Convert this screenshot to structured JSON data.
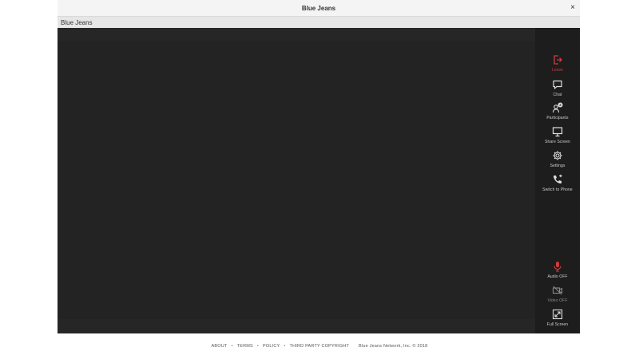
{
  "window": {
    "title": "Blue Jeans",
    "close_glyph": "×",
    "tab_label": "Blue Jeans"
  },
  "sidebar": {
    "leave": {
      "label": "Leave",
      "icon": "leave-icon",
      "color": "#d23a3a"
    },
    "chat": {
      "label": "Chat",
      "icon": "chat-icon"
    },
    "participants": {
      "label": "Participants",
      "icon": "participants-icon",
      "count": "2"
    },
    "share_screen": {
      "label": "Share Screen",
      "icon": "monitor-icon"
    },
    "settings": {
      "label": "Settings",
      "icon": "gear-icon"
    },
    "switch_to_phone": {
      "label": "Switch to Phone",
      "icon": "phone-icon"
    },
    "audio": {
      "label": "Audio OFF",
      "icon": "microphone-muted-icon",
      "color": "#d23a3a"
    },
    "video": {
      "label": "Video OFF",
      "icon": "camera-off-icon"
    },
    "full_screen": {
      "label": "Full Screen",
      "icon": "fullscreen-icon"
    }
  },
  "footer": {
    "about": "ABOUT",
    "terms": "TERMS",
    "policy": "POLICY",
    "third_party": "THIRD PARTY COPYRIGHT",
    "copyright": "Blue Jeans Network, Inc. © 2018",
    "separator": "•"
  }
}
